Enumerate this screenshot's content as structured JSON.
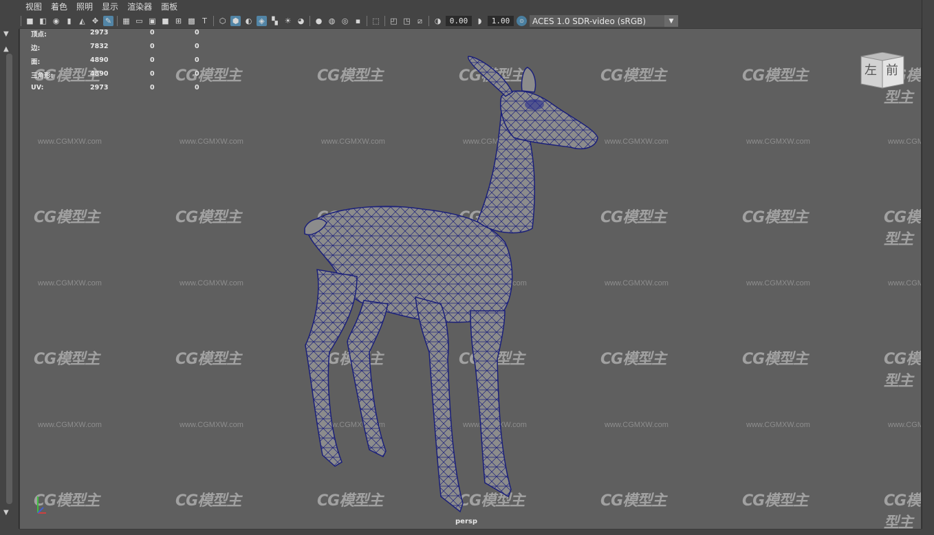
{
  "menu": {
    "items": [
      "视图",
      "着色",
      "照明",
      "显示",
      "渲染器",
      "面板"
    ]
  },
  "toolbar": {
    "exposure_value": "0.00",
    "gamma_value": "1.00",
    "color_space": "ACES 1.0 SDR-video (sRGB)"
  },
  "hud": {
    "rows": [
      {
        "label": "顶点:",
        "value": "2973",
        "sel": "0",
        "uv": "0"
      },
      {
        "label": "边:",
        "value": "7832",
        "sel": "0",
        "uv": "0"
      },
      {
        "label": "面:",
        "value": "4890",
        "sel": "0",
        "uv": "0"
      },
      {
        "label": "三角形:",
        "value": "4890",
        "sel": "0",
        "uv": "0"
      },
      {
        "label": "UV:",
        "value": "2973",
        "sel": "0",
        "uv": "0"
      }
    ]
  },
  "viewcube": {
    "left_label": "左",
    "front_label": "前"
  },
  "camera_label": "persp",
  "watermark": {
    "logo": "CG模型主",
    "url": "www.CGMXW.com"
  },
  "colors": {
    "viewport_bg": "#5f5f5f",
    "wire": "#1a1f7a",
    "mesh": "#8a8a8a",
    "accent": "#5285a6"
  },
  "icons": [
    "camera-icon",
    "grid-icon",
    "wireframe-icon",
    "shaded-icon",
    "light-icon",
    "isolate-icon",
    "ocio-icon"
  ]
}
